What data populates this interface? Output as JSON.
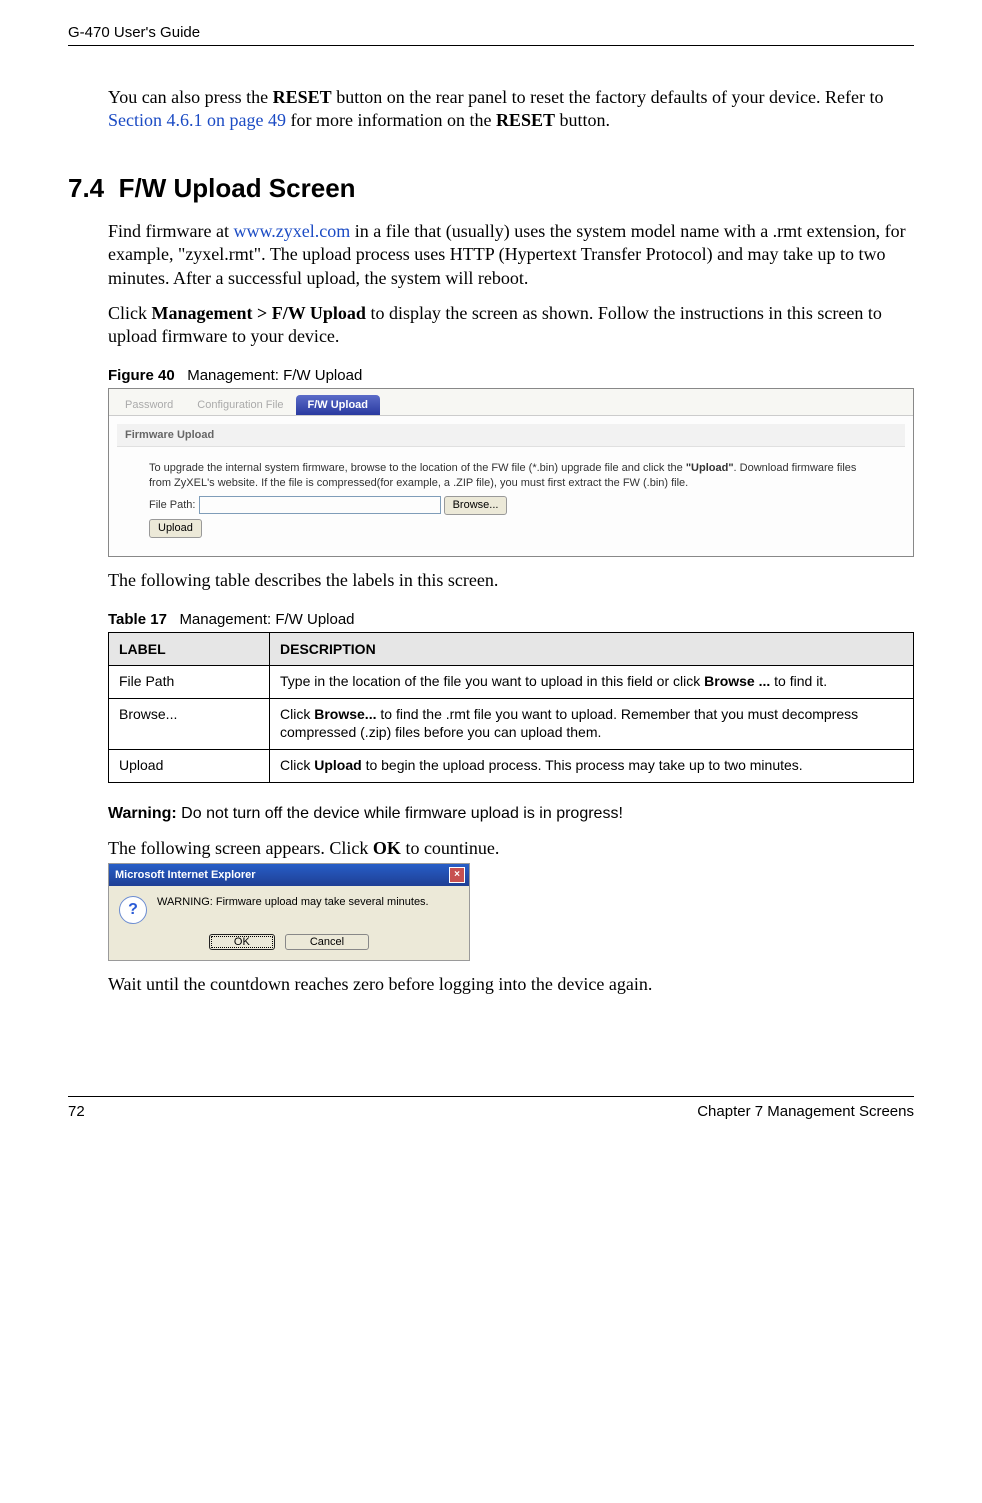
{
  "header": {
    "title": "G-470 User's Guide"
  },
  "intro": {
    "reset": {
      "pre": "You can also press the ",
      "bold1": "RESET",
      "mid": " button on the rear panel to reset the factory defaults of your device. Refer to ",
      "link": "Section 4.6.1 on page 49",
      "post": " for more information on the ",
      "bold2": "RESET",
      "end": " button."
    }
  },
  "h2": {
    "num": "7.4",
    "title": "F/W Upload Screen"
  },
  "p1": {
    "pre": "Find firmware at ",
    "link": "www.zyxel.com",
    "post": " in a file that (usually) uses the system model name with a .rmt extension, for example, \"zyxel.rmt\". The upload process uses HTTP (Hypertext Transfer Protocol) and may take up to two minutes. After a successful upload, the system will reboot."
  },
  "p2": {
    "pre": "Click ",
    "bold": "Management > F/W Upload",
    "post": " to display the screen as shown. Follow the instructions in this screen to upload firmware to your device."
  },
  "figcap": {
    "label": "Figure 40",
    "text": "Management: F/W Upload"
  },
  "fig": {
    "tabs": {
      "password": "Password",
      "config": "Configuration File",
      "fwupload": "F/W Upload"
    },
    "sectionTitle": "Firmware Upload",
    "text_pre": "To upgrade the internal system firmware, browse to the location of the FW file (*.bin) upgrade file and click the ",
    "text_bold": "\"Upload\"",
    "text_post": ". Download firmware files from ZyXEL's website. If the file is compressed(for example, a .ZIP file), you must first extract the FW (.bin) file.",
    "filePathLabel": "File Path:",
    "browseBtn": "Browse...",
    "uploadBtn": "Upload"
  },
  "p3": "The following table describes the labels in this screen.",
  "tablecap": {
    "label": "Table 17",
    "text": "Management: F/W Upload"
  },
  "table": {
    "headers": {
      "label": "LABEL",
      "desc": "DESCRIPTION"
    },
    "rows": [
      {
        "label": "File Path",
        "desc_pre": "Type in the location of the file you want to upload in this field or click ",
        "desc_bold": "Browse ...",
        "desc_post": " to find it."
      },
      {
        "label": "Browse...",
        "desc_pre": "Click ",
        "desc_bold": "Browse...",
        "desc_post": " to find the .rmt file you want to upload. Remember that you must decompress compressed (.zip) files before you can upload them."
      },
      {
        "label": "Upload",
        "desc_pre": "Click ",
        "desc_bold": "Upload",
        "desc_post": " to begin the upload process. This process may take up to two minutes."
      }
    ]
  },
  "warn": {
    "label": "Warning:",
    "text": " Do not turn off the device while firmware upload is in progress!"
  },
  "p4": {
    "pre": "The following screen appears. Click ",
    "bold": "OK",
    "post": " to countinue."
  },
  "dlg": {
    "title": "Microsoft Internet Explorer",
    "msg": "WARNING: Firmware upload may take several minutes.",
    "ok": "OK",
    "cancel": "Cancel"
  },
  "p5": "Wait until the countdown reaches zero before logging into the device again.",
  "footer": {
    "page": "72",
    "chapter": "Chapter 7 Management Screens"
  }
}
